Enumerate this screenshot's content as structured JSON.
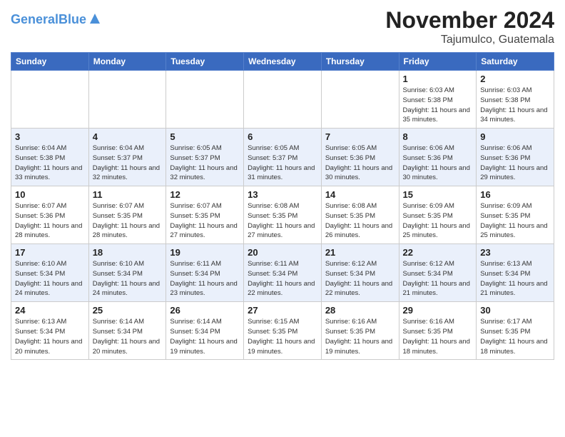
{
  "header": {
    "logo_line1": "General",
    "logo_line2": "Blue",
    "month": "November 2024",
    "location": "Tajumulco, Guatemala"
  },
  "weekdays": [
    "Sunday",
    "Monday",
    "Tuesday",
    "Wednesday",
    "Thursday",
    "Friday",
    "Saturday"
  ],
  "weeks": [
    [
      {
        "day": "",
        "info": ""
      },
      {
        "day": "",
        "info": ""
      },
      {
        "day": "",
        "info": ""
      },
      {
        "day": "",
        "info": ""
      },
      {
        "day": "",
        "info": ""
      },
      {
        "day": "1",
        "info": "Sunrise: 6:03 AM\nSunset: 5:38 PM\nDaylight: 11 hours\nand 35 minutes."
      },
      {
        "day": "2",
        "info": "Sunrise: 6:03 AM\nSunset: 5:38 PM\nDaylight: 11 hours\nand 34 minutes."
      }
    ],
    [
      {
        "day": "3",
        "info": "Sunrise: 6:04 AM\nSunset: 5:38 PM\nDaylight: 11 hours\nand 33 minutes."
      },
      {
        "day": "4",
        "info": "Sunrise: 6:04 AM\nSunset: 5:37 PM\nDaylight: 11 hours\nand 32 minutes."
      },
      {
        "day": "5",
        "info": "Sunrise: 6:05 AM\nSunset: 5:37 PM\nDaylight: 11 hours\nand 32 minutes."
      },
      {
        "day": "6",
        "info": "Sunrise: 6:05 AM\nSunset: 5:37 PM\nDaylight: 11 hours\nand 31 minutes."
      },
      {
        "day": "7",
        "info": "Sunrise: 6:05 AM\nSunset: 5:36 PM\nDaylight: 11 hours\nand 30 minutes."
      },
      {
        "day": "8",
        "info": "Sunrise: 6:06 AM\nSunset: 5:36 PM\nDaylight: 11 hours\nand 30 minutes."
      },
      {
        "day": "9",
        "info": "Sunrise: 6:06 AM\nSunset: 5:36 PM\nDaylight: 11 hours\nand 29 minutes."
      }
    ],
    [
      {
        "day": "10",
        "info": "Sunrise: 6:07 AM\nSunset: 5:36 PM\nDaylight: 11 hours\nand 28 minutes."
      },
      {
        "day": "11",
        "info": "Sunrise: 6:07 AM\nSunset: 5:35 PM\nDaylight: 11 hours\nand 28 minutes."
      },
      {
        "day": "12",
        "info": "Sunrise: 6:07 AM\nSunset: 5:35 PM\nDaylight: 11 hours\nand 27 minutes."
      },
      {
        "day": "13",
        "info": "Sunrise: 6:08 AM\nSunset: 5:35 PM\nDaylight: 11 hours\nand 27 minutes."
      },
      {
        "day": "14",
        "info": "Sunrise: 6:08 AM\nSunset: 5:35 PM\nDaylight: 11 hours\nand 26 minutes."
      },
      {
        "day": "15",
        "info": "Sunrise: 6:09 AM\nSunset: 5:35 PM\nDaylight: 11 hours\nand 25 minutes."
      },
      {
        "day": "16",
        "info": "Sunrise: 6:09 AM\nSunset: 5:35 PM\nDaylight: 11 hours\nand 25 minutes."
      }
    ],
    [
      {
        "day": "17",
        "info": "Sunrise: 6:10 AM\nSunset: 5:34 PM\nDaylight: 11 hours\nand 24 minutes."
      },
      {
        "day": "18",
        "info": "Sunrise: 6:10 AM\nSunset: 5:34 PM\nDaylight: 11 hours\nand 24 minutes."
      },
      {
        "day": "19",
        "info": "Sunrise: 6:11 AM\nSunset: 5:34 PM\nDaylight: 11 hours\nand 23 minutes."
      },
      {
        "day": "20",
        "info": "Sunrise: 6:11 AM\nSunset: 5:34 PM\nDaylight: 11 hours\nand 22 minutes."
      },
      {
        "day": "21",
        "info": "Sunrise: 6:12 AM\nSunset: 5:34 PM\nDaylight: 11 hours\nand 22 minutes."
      },
      {
        "day": "22",
        "info": "Sunrise: 6:12 AM\nSunset: 5:34 PM\nDaylight: 11 hours\nand 21 minutes."
      },
      {
        "day": "23",
        "info": "Sunrise: 6:13 AM\nSunset: 5:34 PM\nDaylight: 11 hours\nand 21 minutes."
      }
    ],
    [
      {
        "day": "24",
        "info": "Sunrise: 6:13 AM\nSunset: 5:34 PM\nDaylight: 11 hours\nand 20 minutes."
      },
      {
        "day": "25",
        "info": "Sunrise: 6:14 AM\nSunset: 5:34 PM\nDaylight: 11 hours\nand 20 minutes."
      },
      {
        "day": "26",
        "info": "Sunrise: 6:14 AM\nSunset: 5:34 PM\nDaylight: 11 hours\nand 19 minutes."
      },
      {
        "day": "27",
        "info": "Sunrise: 6:15 AM\nSunset: 5:35 PM\nDaylight: 11 hours\nand 19 minutes."
      },
      {
        "day": "28",
        "info": "Sunrise: 6:16 AM\nSunset: 5:35 PM\nDaylight: 11 hours\nand 19 minutes."
      },
      {
        "day": "29",
        "info": "Sunrise: 6:16 AM\nSunset: 5:35 PM\nDaylight: 11 hours\nand 18 minutes."
      },
      {
        "day": "30",
        "info": "Sunrise: 6:17 AM\nSunset: 5:35 PM\nDaylight: 11 hours\nand 18 minutes."
      }
    ]
  ]
}
